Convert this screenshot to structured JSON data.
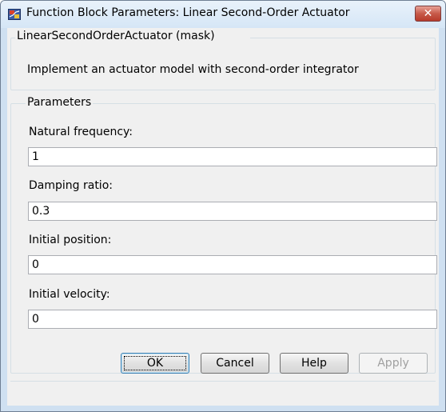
{
  "window": {
    "title": "Function Block Parameters: Linear Second-Order Actuator",
    "close_glyph": "✕"
  },
  "mask": {
    "group_title": "LinearSecondOrderActuator (mask)",
    "description": "Implement an actuator model with second-order integrator"
  },
  "parameters": {
    "group_title": "Parameters",
    "fields": [
      {
        "label": "Natural frequency:",
        "value": "1"
      },
      {
        "label": "Damping ratio:",
        "value": "0.3"
      },
      {
        "label": "Initial position:",
        "value": "0"
      },
      {
        "label": "Initial velocity:",
        "value": "0"
      }
    ]
  },
  "buttons": {
    "ok": "OK",
    "cancel": "Cancel",
    "help": "Help",
    "apply": "Apply"
  },
  "colors": {
    "frame": "#cfe0f1",
    "client": "#f0f0f0",
    "close_button": "#c75a4a"
  }
}
